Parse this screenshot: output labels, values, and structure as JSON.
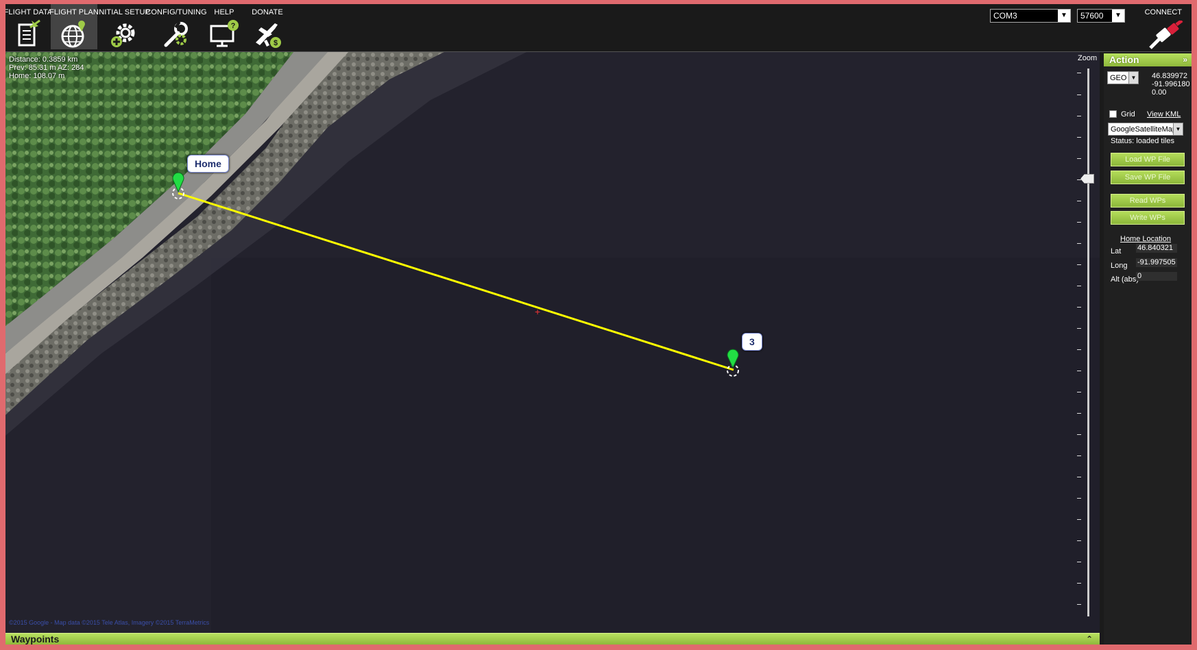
{
  "toolbar": {
    "items": [
      {
        "label": "FLIGHT DATA",
        "icon": "clipboard-plane-icon"
      },
      {
        "label": "FLIGHT PLAN",
        "icon": "globe-pin-icon"
      },
      {
        "label": "INITIAL SETUP",
        "icon": "gear-plus-icon"
      },
      {
        "label": "CONFIG/TUNING",
        "icon": "wrench-gear-icon"
      },
      {
        "label": "HELP",
        "icon": "monitor-help-icon"
      },
      {
        "label": "DONATE",
        "icon": "plane-dollar-icon"
      }
    ],
    "active_index": 1,
    "port": "COM3",
    "baud": "57600",
    "connect_label": "CONNECT",
    "connect_icon": "plug-icon"
  },
  "map": {
    "info": {
      "distance": "Distance: 0.3859 km",
      "prev": "Prev: 85.31 m AZ: 284",
      "home": "Home: 108.07 m"
    },
    "markers": [
      {
        "label": "Home"
      },
      {
        "label": "3"
      }
    ],
    "zoom_label": "Zoom",
    "center_mark": "+",
    "copyright": "©2015 Google - Map data ©2015 Tele Atlas, Imagery ©2015 TerraMetrics"
  },
  "waypoints_bar": {
    "title": "Waypoints",
    "collapse_icon": "double-chevron-up-icon"
  },
  "panel": {
    "title": "Action",
    "coord_system": "GEO",
    "lat": "46.839972",
    "lng": "-91.996180",
    "alt": "0.00",
    "grid_label": "Grid",
    "grid_checked": false,
    "view_kml": "View KML",
    "map_provider": "GoogleSatelliteMap",
    "status": "Status: loaded tiles",
    "buttons": {
      "load_wp": "Load WP File",
      "save_wp": "Save WP File",
      "read_wps": "Read WPs",
      "write_wps": "Write WPs"
    },
    "home_location_title": "Home Location",
    "home": {
      "lat_label": "Lat",
      "lat": "46.840321",
      "long_label": "Long",
      "long": "-91.997505",
      "alt_label": "Alt (abs)",
      "alt": "0"
    }
  },
  "colors": {
    "accent_green": "#9fcb47",
    "route_yellow": "#ffff00",
    "marker_green": "#22dd44"
  }
}
